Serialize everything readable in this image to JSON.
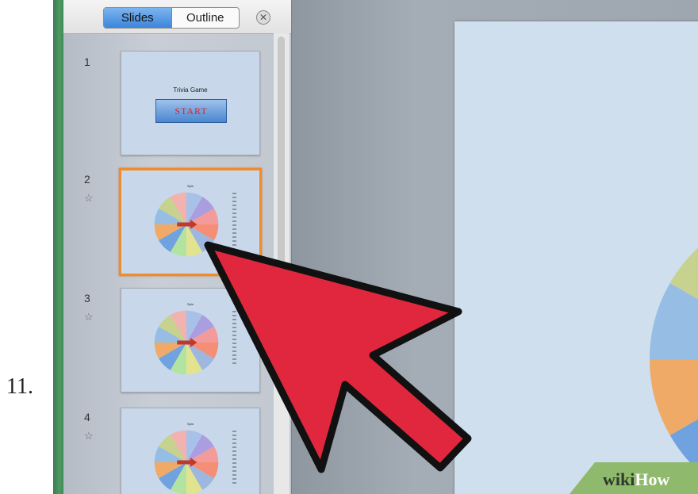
{
  "step_number": "11.",
  "pane": {
    "tabs": [
      {
        "label": "Slides",
        "active": true
      },
      {
        "label": "Outline",
        "active": false
      }
    ],
    "close_icon": "close-circle-icon"
  },
  "slides": [
    {
      "number": "1",
      "title": "Trivia Game",
      "button_label": "START",
      "selected": false
    },
    {
      "number": "2",
      "star": "☆",
      "title": "Spin",
      "selected": true
    },
    {
      "number": "3",
      "star": "☆",
      "title": "Spin",
      "selected": false
    },
    {
      "number": "4",
      "star": "☆",
      "title": "Spin",
      "selected": false
    }
  ],
  "overlay": {
    "pointer_icon": "red-arrow-pointer-icon",
    "pointer_color": "#e0273d"
  },
  "watermark": {
    "wiki": "wiki",
    "how": "How"
  },
  "colors": {
    "selection": "#f08b2d",
    "slide_bg": "#cfdfee",
    "wheel": [
      "#a8c1e8",
      "#ab9ee0",
      "#f39b9b",
      "#f48e76",
      "#9db7de",
      "#e2e38f",
      "#b3e3a1",
      "#6fa2de",
      "#efaa67",
      "#96bde4",
      "#c6d28e",
      "#f1b2b0"
    ]
  }
}
